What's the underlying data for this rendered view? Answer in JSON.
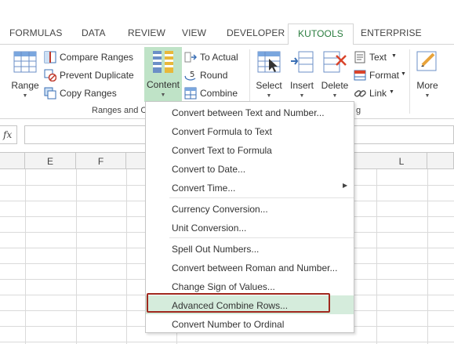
{
  "tabs": [
    {
      "label": "FORMULAS",
      "active": false
    },
    {
      "label": "DATA",
      "active": false
    },
    {
      "label": "REVIEW",
      "active": false
    },
    {
      "label": "VIEW",
      "active": false
    },
    {
      "label": "DEVELOPER",
      "active": false
    },
    {
      "label": "KUTOOLS",
      "active": true
    },
    {
      "label": "ENTERPRISE",
      "active": false
    }
  ],
  "ribbon": {
    "range_label": "Range",
    "compare_ranges": "Compare Ranges",
    "prevent_duplicate": "Prevent Duplicate",
    "copy_ranges": "Copy Ranges",
    "content_label": "Content",
    "to_actual": "To Actual",
    "round": "Round",
    "combine": "Combine",
    "group_label": "Ranges and C",
    "group_label_tail": "g",
    "select_label": "Select",
    "insert_label": "Insert",
    "delete_label": "Delete",
    "text_label": "Text",
    "format_label": "Format",
    "link_label": "Link",
    "more_label": "More"
  },
  "formula_bar": {
    "fx": "fx",
    "value": ""
  },
  "columns": [
    "E",
    "F",
    "L"
  ],
  "menu": {
    "items": [
      "Convert between Text and Number...",
      "Convert Formula to Text",
      "Convert Text to Formula",
      "Convert to Date...",
      "Convert Time...",
      "Currency Conversion...",
      "Unit Conversion...",
      "Spell Out Numbers...",
      "Convert between Roman and Number...",
      "Change Sign of Values...",
      "Advanced Combine Rows...",
      "Convert Number to Ordinal"
    ],
    "highlighted_index": 10,
    "submenu_arrow": "▶"
  },
  "colors": {
    "accent_green": "#2a7d3f",
    "highlight": "#d5ecdc",
    "annotation_red": "#a0281e"
  }
}
